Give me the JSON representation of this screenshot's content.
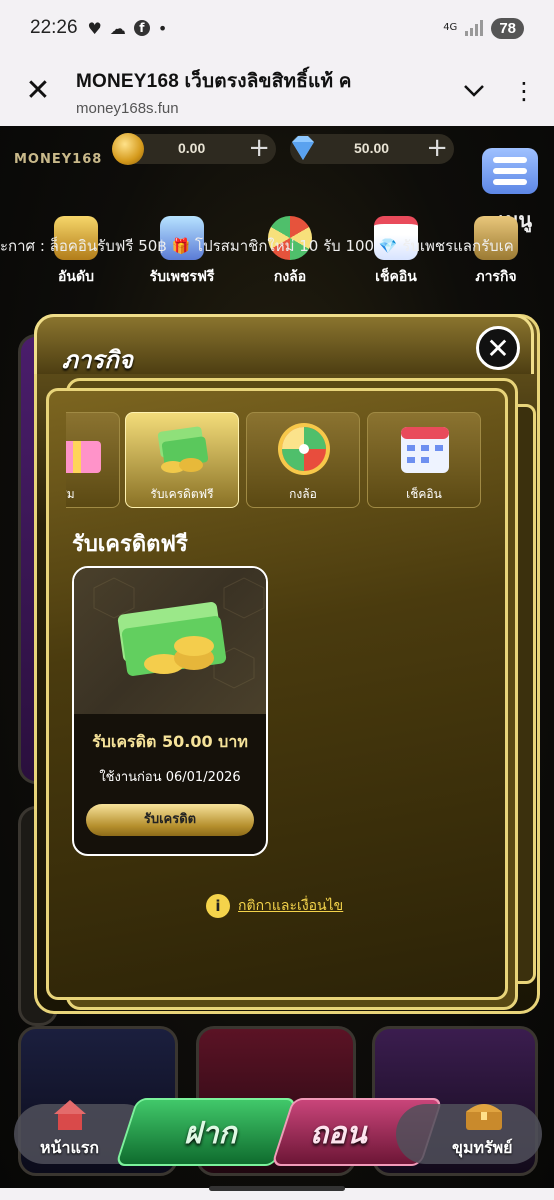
{
  "status": {
    "time": "22:26",
    "network": "4G",
    "battery": "78"
  },
  "browser": {
    "title": "MONEY168 เว็บตรงลิขสิทธิ์แท้ ค",
    "url": "money168s.fun"
  },
  "header": {
    "logo": "MONEY168",
    "credit_balance": "0.00",
    "diamond_balance": "50.00",
    "menu_label": "เมนู",
    "marquee": "ะกาศ : ล็อคอินรับฟรี 50฿ 🎁 โปรสมาชิกใหม่ 10 รับ 100 💎 รับเพชรแลกรับเค"
  },
  "top_icons": [
    {
      "label": "อันดับ",
      "icon": "trophy-icon"
    },
    {
      "label": "รับเพชรฟรี",
      "icon": "gem-chest-icon"
    },
    {
      "label": "กงล้อ",
      "icon": "wheel-icon"
    },
    {
      "label": "เช็คอิน",
      "icon": "calendar-icon"
    },
    {
      "label": "ภารกิจ",
      "icon": "mission-icon"
    }
  ],
  "modal": {
    "title": "ภารกิจ",
    "tabs": [
      {
        "label": "สุ่ม",
        "icon": "gift-icon"
      },
      {
        "label": "รับเครดิตฟรี",
        "icon": "cash-icon",
        "active": true
      },
      {
        "label": "กงล้อ",
        "icon": "wheel-icon"
      },
      {
        "label": "เช็คอิน",
        "icon": "calendar-icon"
      }
    ],
    "section_title": "รับเครดิตฟรี",
    "card": {
      "amount": "รับเครดิต 50.00 บาท",
      "expiry": "ใช้งานก่อน 06/01/2026",
      "button": "รับเครดิต"
    },
    "terms": "กติกาและเงื่อนไข"
  },
  "bottom_nav": {
    "home": "หน้าแรก",
    "deposit": "ฝาก",
    "withdraw": "ถอน",
    "treasure": "ขุมทรัพย์"
  }
}
